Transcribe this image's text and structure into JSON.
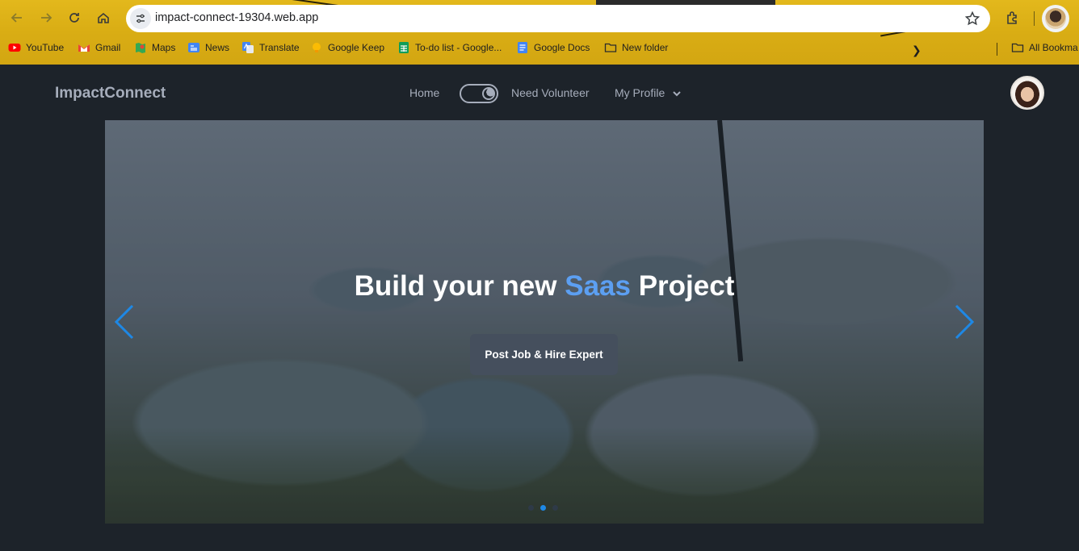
{
  "browser": {
    "url": "impact-connect-19304.web.app",
    "bookmarks": [
      {
        "label": "YouTube",
        "icon": "youtube-icon",
        "color": "#ff0000"
      },
      {
        "label": "Gmail",
        "icon": "gmail-icon",
        "color": "#ea4335"
      },
      {
        "label": "Maps",
        "icon": "maps-icon",
        "color": "#34a853"
      },
      {
        "label": "News",
        "icon": "news-icon",
        "color": "#4285f4"
      },
      {
        "label": "Translate",
        "icon": "translate-icon",
        "color": "#4285f4"
      },
      {
        "label": "Google Keep",
        "icon": "keep-icon",
        "color": "#fbbc04"
      },
      {
        "label": "To-do list - Google...",
        "icon": "sheets-icon",
        "color": "#0f9d58"
      },
      {
        "label": "Google Docs",
        "icon": "docs-icon",
        "color": "#4285f4"
      },
      {
        "label": "New folder",
        "icon": "folder-icon",
        "color": "#3c3c3c"
      }
    ],
    "all_bookmarks": "All Bookma"
  },
  "app": {
    "brand": "ImpactConnect",
    "nav": {
      "home": "Home",
      "need_volunteer": "Need Volunteer",
      "my_profile": "My Profile"
    },
    "theme_toggle": "dark"
  },
  "hero": {
    "title_part1": "Build your new ",
    "title_accent": "Saas",
    "title_part2": " Project",
    "cta": "Post Job & Hire Expert",
    "accent_color": "#5c9ff2",
    "slide_index": 2,
    "slide_count": 3
  }
}
